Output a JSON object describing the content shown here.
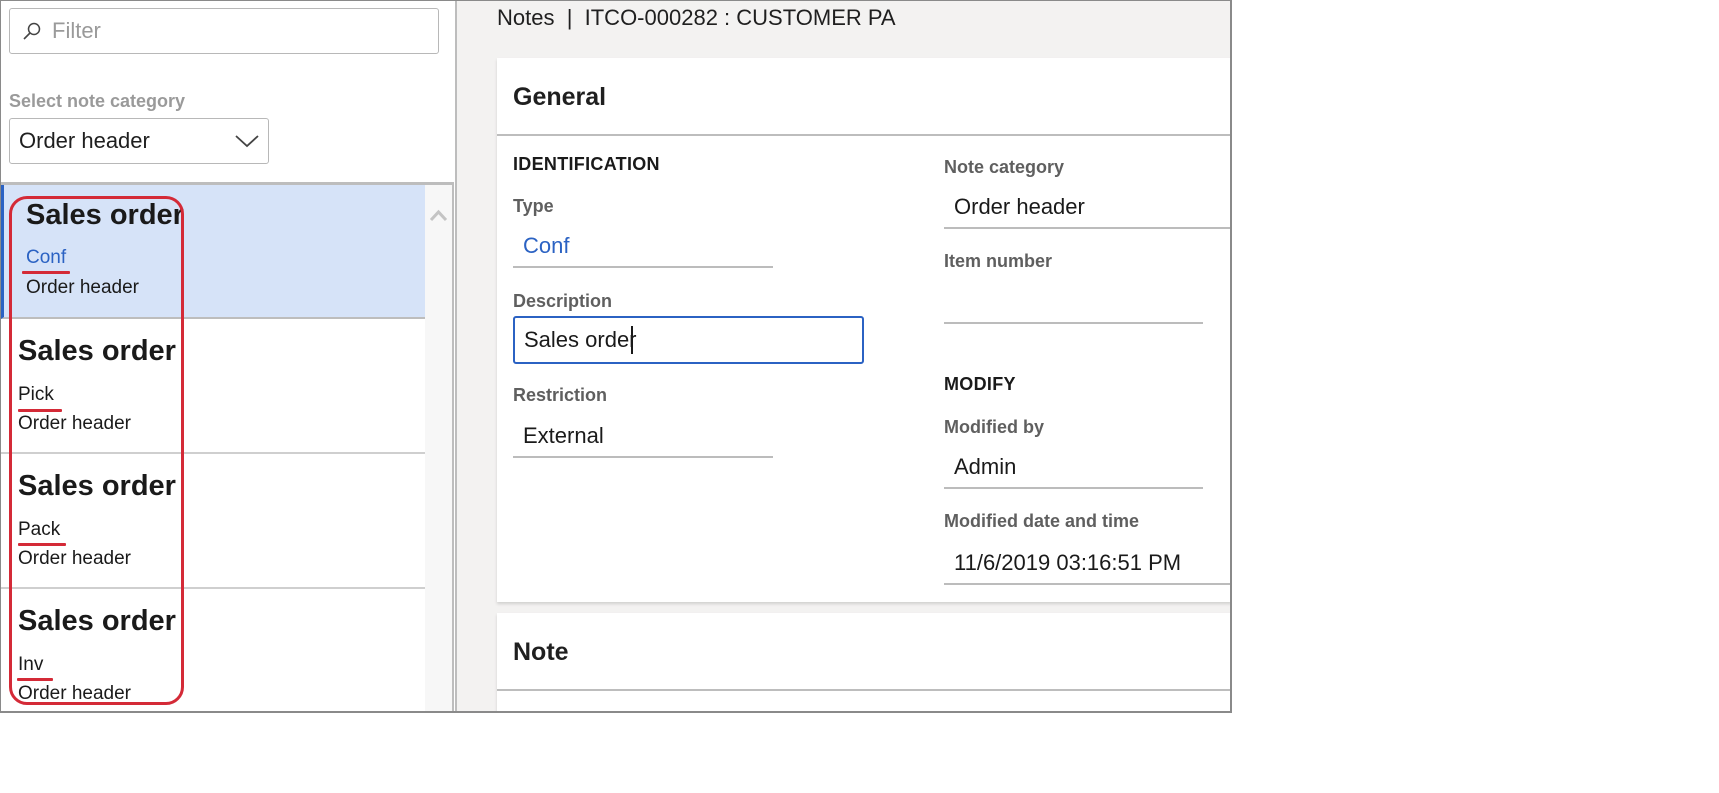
{
  "filter": {
    "placeholder": "Filter",
    "value": "",
    "icon": "search-icon"
  },
  "category_selector": {
    "label": "Select note category",
    "selected": "Order header",
    "icon": "chevron-down-icon"
  },
  "notes_list": [
    {
      "title": "Sales order",
      "type": "Conf",
      "category": "Order header",
      "selected": true
    },
    {
      "title": "Sales order",
      "type": "Pick",
      "category": "Order header",
      "selected": false
    },
    {
      "title": "Sales order",
      "type": "Pack",
      "category": "Order header",
      "selected": false
    },
    {
      "title": "Sales order",
      "type": "Inv",
      "category": "Order header",
      "selected": false
    }
  ],
  "header": {
    "title": "Notes  |  ITCO-000282 : CUSTOMER PA"
  },
  "general": {
    "title": "General",
    "identification": {
      "group_title": "IDENTIFICATION",
      "type_label": "Type",
      "type_value": "Conf",
      "description_label": "Description",
      "description_value": "Sales order",
      "restriction_label": "Restriction",
      "restriction_value": "External"
    },
    "right": {
      "note_category_label": "Note category",
      "note_category_value": "Order header",
      "item_number_label": "Item number",
      "item_number_value": ""
    },
    "modify": {
      "group_title": "MODIFY",
      "modified_by_label": "Modified by",
      "modified_by_value": "Admin",
      "modified_datetime_label": "Modified date and time",
      "modified_datetime_value": "11/6/2019 03:16:51 PM"
    }
  },
  "note_section": {
    "title": "Note"
  },
  "colors": {
    "accent": "#2b62c3",
    "selected_bg": "#d6e3f8",
    "annotation_red": "#d42a37",
    "page_bg": "#f3f2f1"
  }
}
